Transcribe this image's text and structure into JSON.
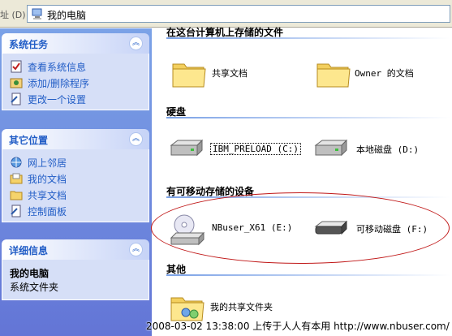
{
  "address_bar": {
    "label": "址 (D)",
    "path": "我的电脑"
  },
  "left_pane": {
    "system_tasks": {
      "title": "系统任务",
      "items": [
        {
          "label": "查看系统信息",
          "icon": "system-info-icon"
        },
        {
          "label": "添加/删除程序",
          "icon": "add-remove-icon"
        },
        {
          "label": "更改一个设置",
          "icon": "settings-icon"
        }
      ]
    },
    "other_places": {
      "title": "其它位置",
      "items": [
        {
          "label": "网上邻居",
          "icon": "network-icon"
        },
        {
          "label": "我的文档",
          "icon": "documents-icon"
        },
        {
          "label": "共享文档",
          "icon": "folder-icon"
        },
        {
          "label": "控制面板",
          "icon": "control-panel-icon"
        }
      ]
    },
    "details": {
      "title": "详细信息",
      "name": "我的电脑",
      "type": "系统文件夹"
    }
  },
  "content": {
    "groups": [
      {
        "title": "在这台计算机上存储的文件",
        "items": [
          {
            "label": "共享文档",
            "icon": "folder-icon"
          },
          {
            "label": "Owner 的文档",
            "icon": "folder-icon"
          }
        ]
      },
      {
        "title": "硬盘",
        "items": [
          {
            "label": "IBM_PRELOAD (C:)",
            "icon": "hard-drive-icon",
            "selected": true
          },
          {
            "label": "本地磁盘 (D:)",
            "icon": "hard-drive-icon"
          }
        ]
      },
      {
        "title": "有可移动存储的设备",
        "items": [
          {
            "label": "NBuser_X61 (E:)",
            "icon": "cd-drive-icon"
          },
          {
            "label": "可移动磁盘 (F:)",
            "icon": "removable-disk-icon"
          }
        ]
      },
      {
        "title": "其他",
        "items": [
          {
            "label": "我的共享文件夹",
            "icon": "shared-folder-icon"
          }
        ]
      }
    ]
  },
  "watermark": "2008-03-02 13:38:00 上传于人人有本用 http://www.nbuser.com/",
  "colors": {
    "pane_top": "#7ba2e7",
    "pane_bottom": "#6375d6",
    "panel_title": "#215dc6",
    "annotation": "#c01818"
  }
}
